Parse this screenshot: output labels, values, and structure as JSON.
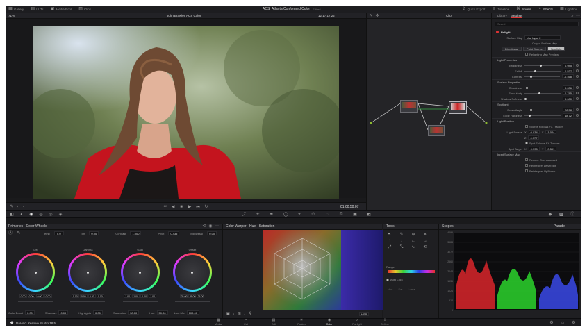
{
  "top_tabs": [
    "Gallery",
    "LUTs",
    "Media Pool",
    "Clips"
  ],
  "project_title": "ACS_Atlanta Conformed Color",
  "project_status": "Edited",
  "top_right_tabs": [
    "Quick Export",
    "Timeline",
    "Nodes",
    "Effects",
    "Lightbox"
  ],
  "viewer": {
    "zoom": "71%",
    "clip_title": "John Brawley ACS Color",
    "source_timecode": "12:17:17:22",
    "timecode": "01:00:50:07"
  },
  "node_bar": {
    "clip_label": "Clip"
  },
  "settings": {
    "tabs": [
      "Library",
      "Settings"
    ],
    "search_placeholder": "Search",
    "plugin": "Relight",
    "surface_map_label": "Surface Map",
    "surface_map_value": "Use Input 2",
    "output_surface_map": "Output Surface Map",
    "light_modes": [
      "Directional",
      "Point Source",
      "Spotlight"
    ],
    "relighting_preview": "Relighting Map Preview",
    "light_properties": "Light Properties",
    "brightness": {
      "label": "Brightness",
      "value": "0.945"
    },
    "falloff": {
      "label": "Falloff",
      "value": "0.537"
    },
    "contrast": {
      "label": "Contrast",
      "value": "-0.468"
    },
    "surface_properties": "Surface Properties",
    "glossiness": {
      "label": "Glossiness",
      "value": "0.036"
    },
    "specularity": {
      "label": "Specularity",
      "value": "0.785"
    },
    "shadow_softness": {
      "label": "Shadow Softness",
      "value": "0.000"
    },
    "spotlight": "Spotlight",
    "beam_angle": {
      "label": "Beam Angle",
      "value": "28.58"
    },
    "edge_hardness": {
      "label": "Edge Hardness",
      "value": "18.72"
    },
    "light_position": "Light Position",
    "source_follows": "Source Follows FX Tracker",
    "light_source": {
      "label": "Light Source",
      "x": "0.034",
      "y": "1.024",
      "z": "0.777"
    },
    "spot_follows": "Spot Follows FX Tracker",
    "spot_target": {
      "label": "Spot Target",
      "x": "0.335",
      "y": "0.591"
    },
    "input_surface_map": "Input Surface Map",
    "input_options": [
      "Recolor Oversaturated",
      "Reinterpret Left/Right",
      "Reinterpret Up/Down"
    ]
  },
  "primaries": {
    "title": "Primaries - Color Wheels",
    "temp_label": "Temp",
    "temp": "0.0",
    "tint_label": "Tint",
    "tint": "0.00",
    "contrast_label": "Contrast",
    "contrast": "1.000",
    "pivot_label": "Pivot",
    "pivot": "0.435",
    "middetail_label": "Mid/Detail",
    "middetail": "0.00",
    "wheels": [
      {
        "name": "Lift",
        "values": [
          "0.00",
          "0.00",
          "0.00",
          "0.00"
        ]
      },
      {
        "name": "Gamma",
        "values": [
          "0.00",
          "0.00",
          "0.00",
          "0.00"
        ]
      },
      {
        "name": "Gain",
        "values": [
          "1.00",
          "1.00",
          "1.00",
          "1.00"
        ]
      },
      {
        "name": "Offset",
        "values": [
          "25.00",
          "25.00",
          "25.00"
        ]
      }
    ],
    "color_boost_label": "Color Boost",
    "color_boost": "0.00",
    "shadows_label": "Shadows",
    "shadows": "0.00",
    "highlights_label": "Highlights",
    "highlights": "0.00",
    "saturation_label": "Saturation",
    "saturation": "50.00",
    "hue_label": "Hue",
    "hue": "50.00",
    "lummix_label": "Lum Mix",
    "lummix": "100.00"
  },
  "warper": {
    "title": "Color Warper - Hue - Saturation",
    "footer_labels": [
      "4",
      "4"
    ],
    "mode": "HSP"
  },
  "tools": {
    "title": "Tools",
    "range_label": "Range",
    "autolock_label": "Auto Lock",
    "grid_labels": [
      "Hue",
      "Sat",
      "Luma"
    ]
  },
  "scopes": {
    "title": "Scopes",
    "mode": "Parade",
    "ticks": [
      "4095",
      "3584",
      "3072",
      "2560",
      "2048",
      "1536",
      "1024",
      "512",
      "0"
    ]
  },
  "nav": {
    "app_name": "DaVinci Resolve Studio 18.5",
    "pages": [
      "Media",
      "Cut",
      "Edit",
      "Fusion",
      "Color",
      "Fairlight",
      "Deliver"
    ],
    "active": "Color"
  }
}
